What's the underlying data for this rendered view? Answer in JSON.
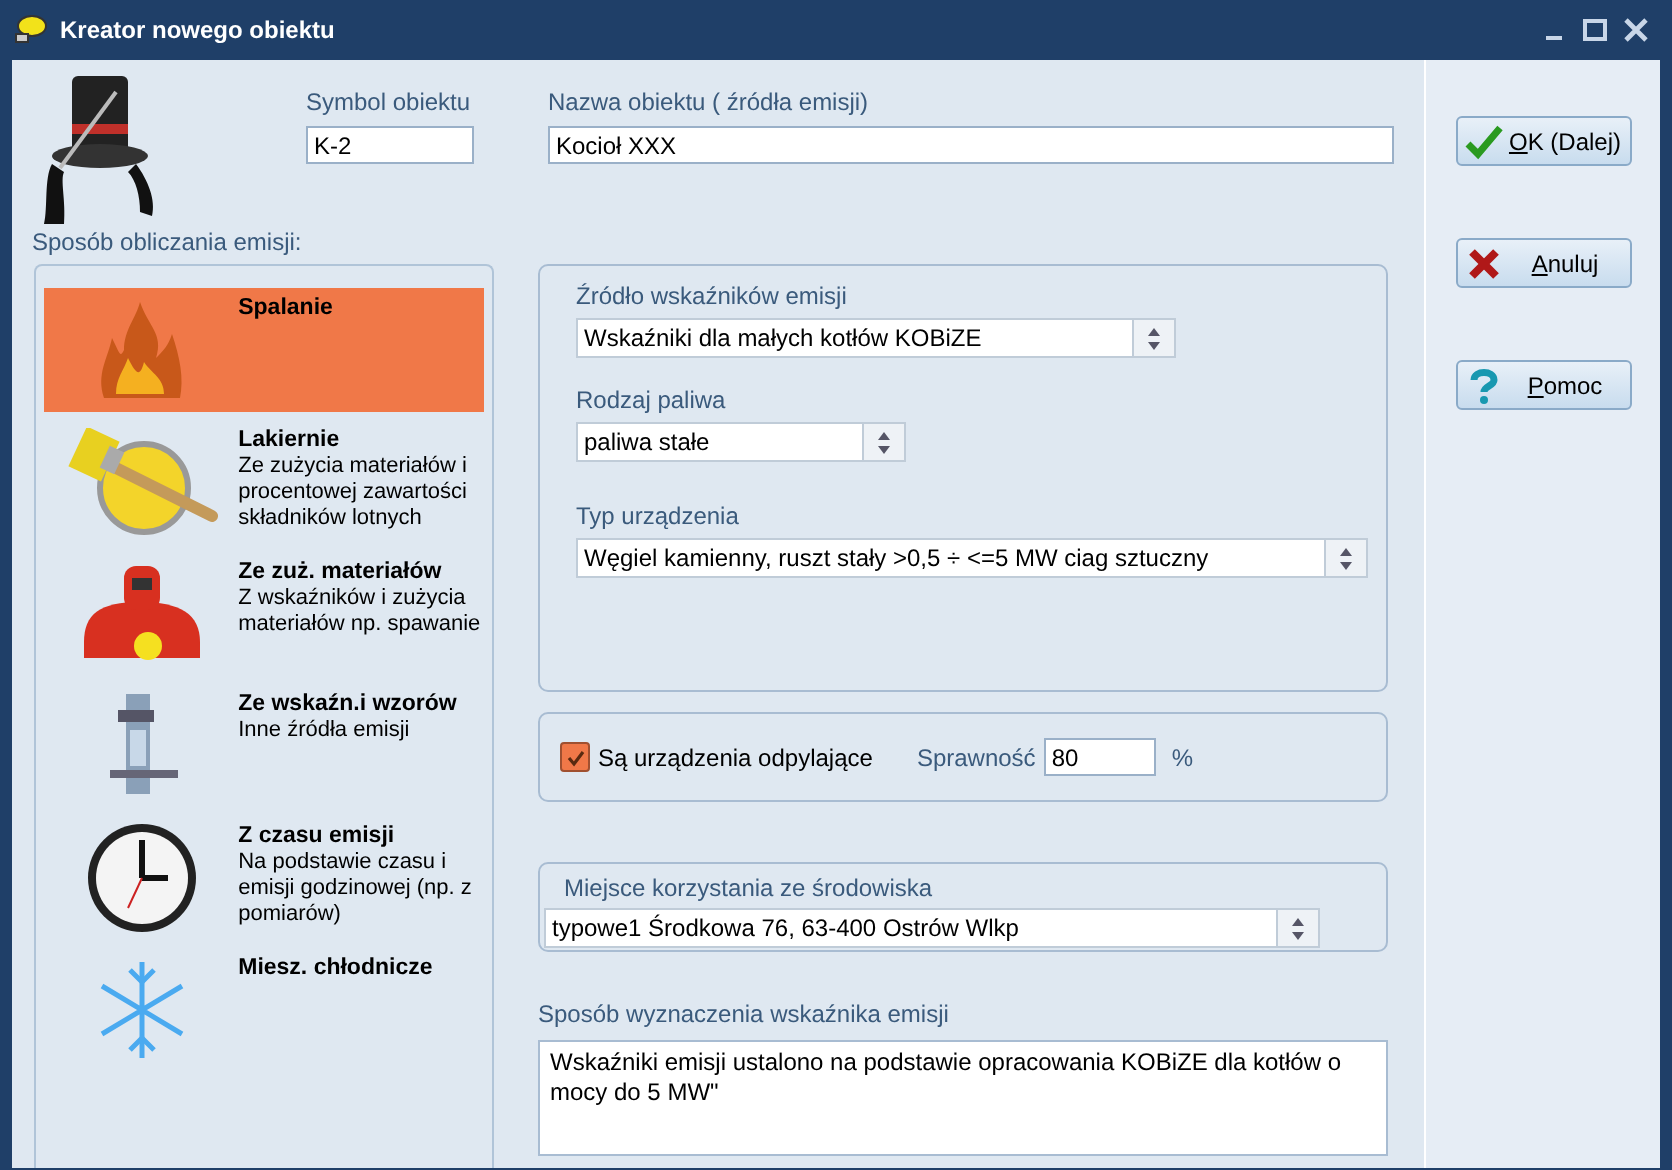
{
  "window": {
    "title": "Kreator nowego obiektu"
  },
  "symbol": {
    "label": "Symbol obiektu",
    "value": "K-2"
  },
  "name": {
    "label": "Nazwa obiektu ( źródła emisji)",
    "value": "Kocioł XXX"
  },
  "methods_label": "Sposób obliczania emisji:",
  "methods": [
    {
      "title": "Spalanie",
      "selected": true
    },
    {
      "title": "Lakiernie",
      "description": "Ze zużycia materiałów i procentowej zawartości składników lotnych",
      "selected": false
    },
    {
      "title": "Ze zuż. materiałów",
      "description": "Z wskaźników i zużycia materiałów np. spawanie",
      "selected": false
    },
    {
      "title": "Ze wskaźn.i wzorów",
      "description": "Inne źródła emisji",
      "selected": false
    },
    {
      "title": "Z czasu emisji",
      "description": "Na podstawie czasu i emisji godzinowej  (np. z pomiarów)",
      "selected": false
    },
    {
      "title": "Miesz. chłodnicze",
      "selected": false
    }
  ],
  "source": {
    "label": "Źródło wskaźników emisji",
    "value": "Wskaźniki dla małych kotłów KOBiZE"
  },
  "fuel": {
    "label": "Rodzaj paliwa",
    "value": "paliwa stałe"
  },
  "device": {
    "label": "Typ urządzenia",
    "value": "Węgiel kamienny, ruszt stały >0,5  ÷ <=5  MW ciag sztuczny"
  },
  "dedusting": {
    "label": "Są urządzenia odpylające",
    "checked": true,
    "efficiency_label": "Sprawność",
    "efficiency": "80",
    "unit": "%"
  },
  "place": {
    "label": "Miejsce korzystania ze środowiska",
    "value": "typowe1 Środkowa 76, 63-400 Ostrów Wlkp"
  },
  "method_note": {
    "label": "Sposób wyznaczenia wskaźnika emisji",
    "value": "Wskaźniki emisji ustalono na podstawie opracowania KOBiZE dla kotłów o mocy do 5 MW\""
  },
  "buttons": [
    {
      "label": "OK (Dalej)",
      "kind": "ok"
    },
    {
      "label": "Anuluj",
      "kind": "cancel"
    },
    {
      "label": "Pomoc",
      "kind": "help"
    }
  ]
}
